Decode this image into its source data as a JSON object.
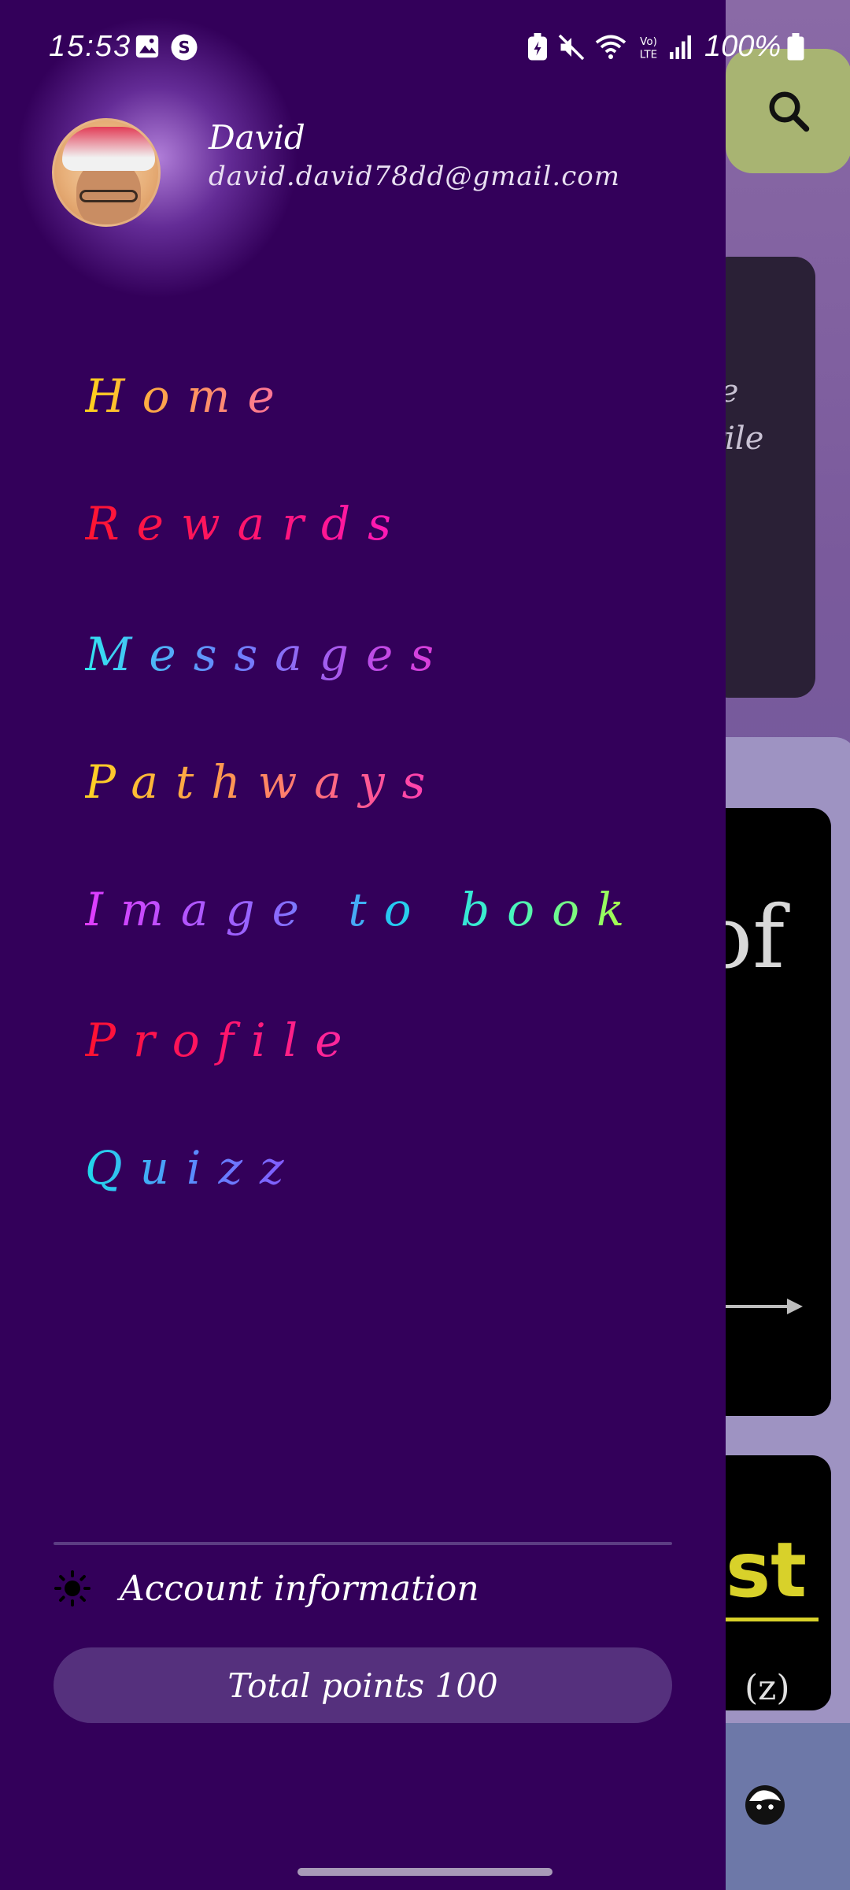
{
  "status_bar": {
    "time": "15:53",
    "battery": "100%",
    "icons": [
      "gallery-icon",
      "s-app-icon",
      "battery-saver-icon",
      "mute-icon",
      "wifi-icon",
      "volte-icon",
      "signal-icon",
      "battery-icon"
    ]
  },
  "drawer": {
    "user": {
      "name": "David",
      "email": "david.david78dd@gmail.com"
    },
    "nav_items": [
      {
        "label": "Home"
      },
      {
        "label": "Rewards"
      },
      {
        "label": "Messages"
      },
      {
        "label": "Pathways"
      },
      {
        "label": "Image to book"
      },
      {
        "label": "Profile"
      },
      {
        "label": "Quizz"
      }
    ],
    "account_label": "Account information",
    "points_label": "Total points 100"
  },
  "background": {
    "card_text_1": "ie",
    "card_text_2": "rile",
    "video_text": "of",
    "quiz_text": "st",
    "quiz_sub": "(z)"
  },
  "colors": {
    "drawer_bg": "#33005a",
    "points_pill": "#55307d",
    "search_button": "#a8b472"
  }
}
